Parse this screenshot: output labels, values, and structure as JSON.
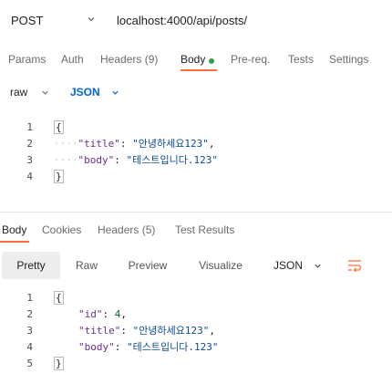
{
  "request": {
    "method": "POST",
    "url": "localhost:4000/api/posts/"
  },
  "request_tabs": {
    "params": "Params",
    "auth": "Auth",
    "headers": "Headers (9)",
    "body": "Body",
    "prereq": "Pre-req.",
    "tests": "Tests",
    "settings": "Settings",
    "active": "Body"
  },
  "body_mode": {
    "type": "raw",
    "format": "JSON"
  },
  "request_body": {
    "line_numbers": [
      "1",
      "2",
      "3",
      "4"
    ],
    "open": "{",
    "close": "}",
    "title_key": "\"title\"",
    "title_value": "\"안녕하세요123\"",
    "body_key": "\"body\"",
    "body_value": "\"테스트입니다.123\"",
    "colon": ":",
    "comma": ","
  },
  "response_tabs": {
    "body": "Body",
    "cookies": "Cookies",
    "headers": "Headers (5)",
    "test_results": "Test Results",
    "active": "Body"
  },
  "view_modes": {
    "pretty": "Pretty",
    "raw": "Raw",
    "preview": "Preview",
    "visualize": "Visualize",
    "format": "JSON",
    "active": "Pretty"
  },
  "response_body": {
    "line_numbers": [
      "1",
      "2",
      "3",
      "4",
      "5"
    ],
    "open": "{",
    "close": "}",
    "id_key": "\"id\"",
    "id_value": "4",
    "title_key": "\"title\"",
    "title_value": "\"안녕하세요123\"",
    "body_key": "\"body\"",
    "body_value": "\"테스트입니다.123\"",
    "colon": ":",
    "comma": ","
  },
  "colors": {
    "accent": "#ff6c37",
    "json_blue": "#0265d2",
    "status_dot": "#2ea043"
  },
  "icons": {
    "method_dropdown": "chevron-down-icon",
    "raw_dropdown": "chevron-down-icon",
    "json_dropdown": "chevron-down-icon",
    "view_json_dropdown": "chevron-down-icon",
    "wrap": "wrap-lines-icon"
  }
}
